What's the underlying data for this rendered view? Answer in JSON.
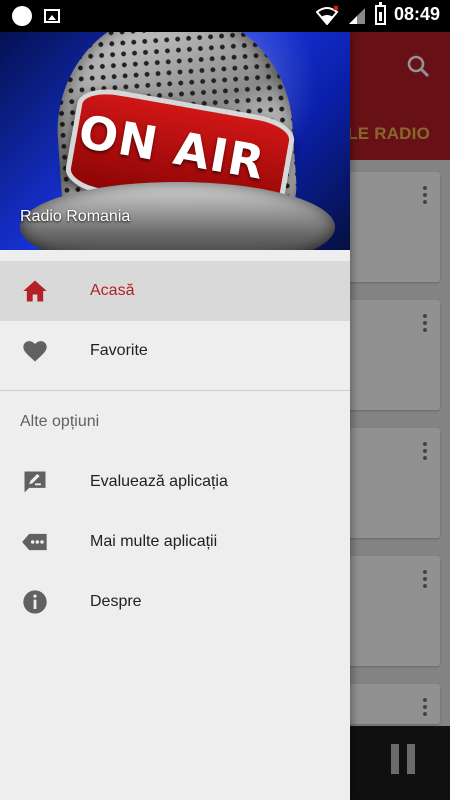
{
  "status_bar": {
    "time": "08:49"
  },
  "drawer": {
    "header": {
      "title": "Radio Romania",
      "image_text": "ON AIR"
    },
    "items": [
      {
        "label": "Acasă",
        "icon": "home-icon",
        "active": true
      },
      {
        "label": "Favorite",
        "icon": "heart-icon",
        "active": false
      }
    ],
    "section": {
      "title": "Alte opțiuni",
      "items": [
        {
          "label": "Evaluează aplicația",
          "icon": "rate-app-icon"
        },
        {
          "label": "Mai multe aplicații",
          "icon": "more-apps-icon"
        },
        {
          "label": "Despre",
          "icon": "info-icon"
        }
      ]
    }
  },
  "background_app": {
    "tab_label": "ILE RADIO"
  },
  "colors": {
    "accent": "#b51f27",
    "tab_text": "#f0b84a",
    "drawer_bg": "#eeeeee",
    "icon": "#616161"
  }
}
